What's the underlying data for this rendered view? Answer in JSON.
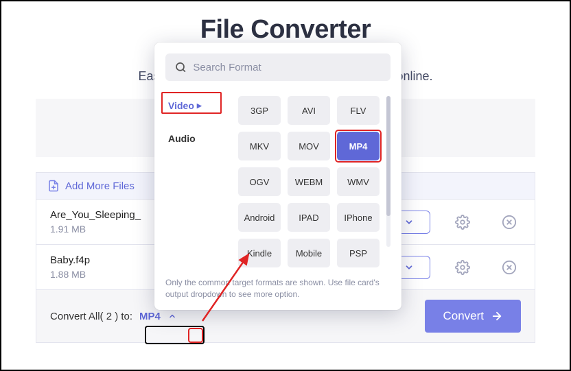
{
  "header": {
    "title": "File Converter",
    "subtitle_left": "Eas",
    "subtitle_right": "online."
  },
  "actions": {
    "add_more": "Add More Files",
    "convert": "Convert"
  },
  "files": [
    {
      "name": "Are_You_Sleeping_",
      "size": "1.91 MB"
    },
    {
      "name": "Baby.f4p",
      "size": "1.88 MB"
    }
  ],
  "convert_all": {
    "label": "Convert All( 2 ) to:",
    "selected": "MP4"
  },
  "popover": {
    "search_placeholder": "Search Format",
    "categories": [
      {
        "label": "Video",
        "active": true
      },
      {
        "label": "Audio",
        "active": false
      }
    ],
    "formats": [
      "3GP",
      "AVI",
      "FLV",
      "MKV",
      "MOV",
      "MP4",
      "OGV",
      "WEBM",
      "WMV",
      "Android",
      "IPAD",
      "IPhone",
      "Kindle",
      "Mobile",
      "PSP"
    ],
    "selected_format": "MP4",
    "note": "Only the common target formats are shown. Use file card's output dropdown to see more option."
  }
}
